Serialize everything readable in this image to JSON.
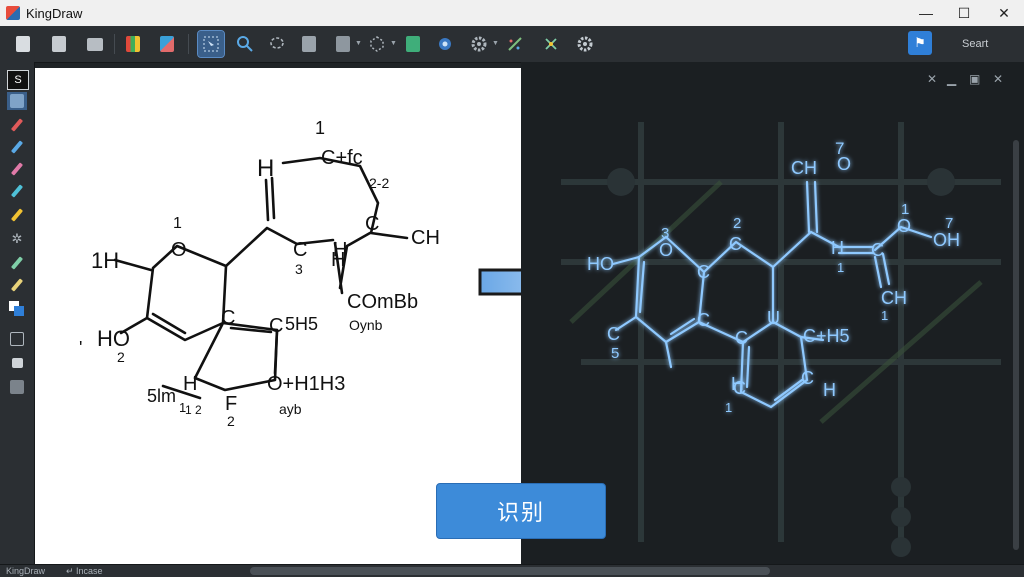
{
  "window": {
    "title": "KingDraw",
    "minimize": "—",
    "maximize": "☐",
    "close": "✕"
  },
  "toolbar": {
    "search_label": "Seart"
  },
  "status": {
    "app": "KingDraw",
    "zoom": "↵ Incase"
  },
  "action": {
    "recognize_label": "识别"
  },
  "colors": {
    "accent": "#3d8bd9",
    "glow": "#8fc9ff"
  },
  "left_molecule": {
    "labels": [
      {
        "t": "1"
      },
      {
        "t": "H"
      },
      {
        "t": "C+fc"
      },
      {
        "t": "2-2"
      },
      {
        "t": "C"
      },
      {
        "t": "CH"
      },
      {
        "t": "1"
      },
      {
        "t": "1H"
      },
      {
        "t": "O"
      },
      {
        "t": "C"
      },
      {
        "t": "H"
      },
      {
        "t": "3"
      },
      {
        "t": "C"
      },
      {
        "t": "5H5"
      },
      {
        "t": "COmBb"
      },
      {
        "t": "Oynb"
      },
      {
        "t": "HO"
      },
      {
        "t": "2"
      },
      {
        "t": "C"
      },
      {
        "t": "5lm"
      },
      {
        "t": "1"
      },
      {
        "t": "F"
      },
      {
        "t": "2"
      },
      {
        "t": "O+H1H3"
      },
      {
        "t": "ayb"
      },
      {
        "t": "H"
      },
      {
        "t": "H"
      },
      {
        "t": "1 2"
      },
      {
        "t": "'"
      }
    ]
  },
  "right_molecule": {
    "labels": [
      {
        "t": "7"
      },
      {
        "t": "CH"
      },
      {
        "t": "O"
      },
      {
        "t": "3"
      },
      {
        "t": "2"
      },
      {
        "t": "1"
      },
      {
        "t": "7"
      },
      {
        "t": "HO"
      },
      {
        "t": "O"
      },
      {
        "t": "C"
      },
      {
        "t": "C"
      },
      {
        "t": "H"
      },
      {
        "t": "C"
      },
      {
        "t": "O"
      },
      {
        "t": "OH"
      },
      {
        "t": "1"
      },
      {
        "t": "C"
      },
      {
        "t": "CH"
      },
      {
        "t": "C"
      },
      {
        "t": "U"
      },
      {
        "t": "C+H5"
      },
      {
        "t": "1"
      },
      {
        "t": "5"
      },
      {
        "t": "C"
      },
      {
        "t": "C"
      },
      {
        "t": "C"
      },
      {
        "t": "H"
      },
      {
        "t": "H"
      },
      {
        "t": "1"
      }
    ]
  }
}
